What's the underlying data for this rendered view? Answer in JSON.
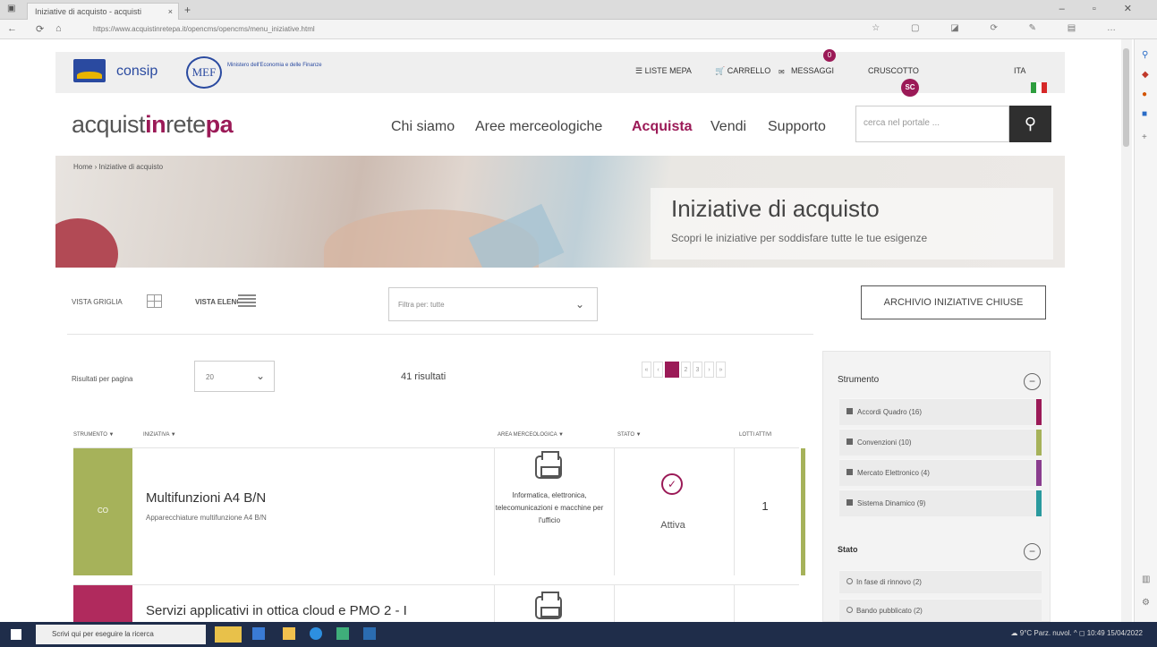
{
  "browser": {
    "tab_title": "Iniziative di acquisto - acquisti",
    "tab_close": "×",
    "new_tab": "+",
    "url": "https://www.acquistinretepa.it/opencms/opencms/menu_iniziative.html",
    "nav_back": "←",
    "nav_forward": "⟳",
    "nav_home": "⌂",
    "window_controls": "– ▫ ✕",
    "tools": "☆ ▢ ◪ ⟳ ✎ ▤ …"
  },
  "util": {
    "consip": "consip",
    "mef": "MEF",
    "mef_desc": "Ministero dell'Economia e delle Finanze",
    "liste": "☰ LISTE MEPA",
    "carrello": "🛒 CARRELLO",
    "messaggi": "MESSAGGI",
    "messaggi_count": "0",
    "avatar": "SC",
    "cruscotto": "CRUSCOTTO",
    "lang": "ITA"
  },
  "nav": {
    "brand_a": "acquist",
    "brand_b": "in",
    "brand_c": "rete",
    "brand_d": "pa",
    "items": [
      "Chi siamo",
      "Aree merceologiche",
      "Acquista",
      "Vendi",
      "Supporto"
    ],
    "search_placeholder": "cerca nel portale ...",
    "search_icon": "⚲"
  },
  "hero": {
    "breadcrumb": "Home  ›  Iniziative di acquisto",
    "title": "Iniziative di acquisto",
    "subtitle": "Scopri le iniziative per soddisfare tutte le tue esigenze"
  },
  "controls": {
    "vista_griglia": "VISTA GRIGLIA",
    "vista_elenco": "VISTA ELENCO",
    "filter_placeholder": "Filtra per: tutte",
    "archive": "ARCHIVIO INIZIATIVE CHIUSE",
    "perpage_label": "Risultati per pagina",
    "perpage_value": "20",
    "results": "41 risultati",
    "pager": [
      "«",
      "‹",
      "1",
      "2",
      "3",
      "›",
      "»"
    ]
  },
  "table": {
    "headers": [
      "STRUMENTO ▼",
      "INIZIATIVA ▼",
      "AREA MERCEOLOGICA ▼",
      "STATO ▼",
      "LOTTI ATTIVI"
    ],
    "rows": [
      {
        "tag": "CO",
        "title": "Multifunzioni A4 B/N",
        "sub": "Apparecchiature multifunzione A4 B/N",
        "cat": "Informatica, elettronica, telecomunicazioni e macchine per l'ufficio",
        "status": "Attiva",
        "count": "1"
      },
      {
        "title": "Servizi applicativi in ottica cloud e PMO 2 - I"
      }
    ]
  },
  "filters": {
    "strumento_title": "Strumento",
    "strumento": [
      "Accordi Quadro (16)",
      "Convenzioni (10)",
      "Mercato Elettronico (4)",
      "Sistema Dinamico (9)"
    ],
    "stato_title": "Stato",
    "stato": [
      "In fase di rinnovo (2)",
      "Bando pubblicato (2)"
    ],
    "collapse": "−"
  },
  "taskbar": {
    "search": "Scrivi qui per eseguire la ricerca",
    "tray": "☁ 9°C Parz. nuvol.  ^  ◻ 10:49  15/04/2022"
  },
  "colors": {
    "accent": "#9b1a57",
    "accordi": "#9b1a57",
    "convenzioni": "#a6b25a",
    "mercato": "#8a3d8e",
    "sistema": "#2a9a9e"
  }
}
